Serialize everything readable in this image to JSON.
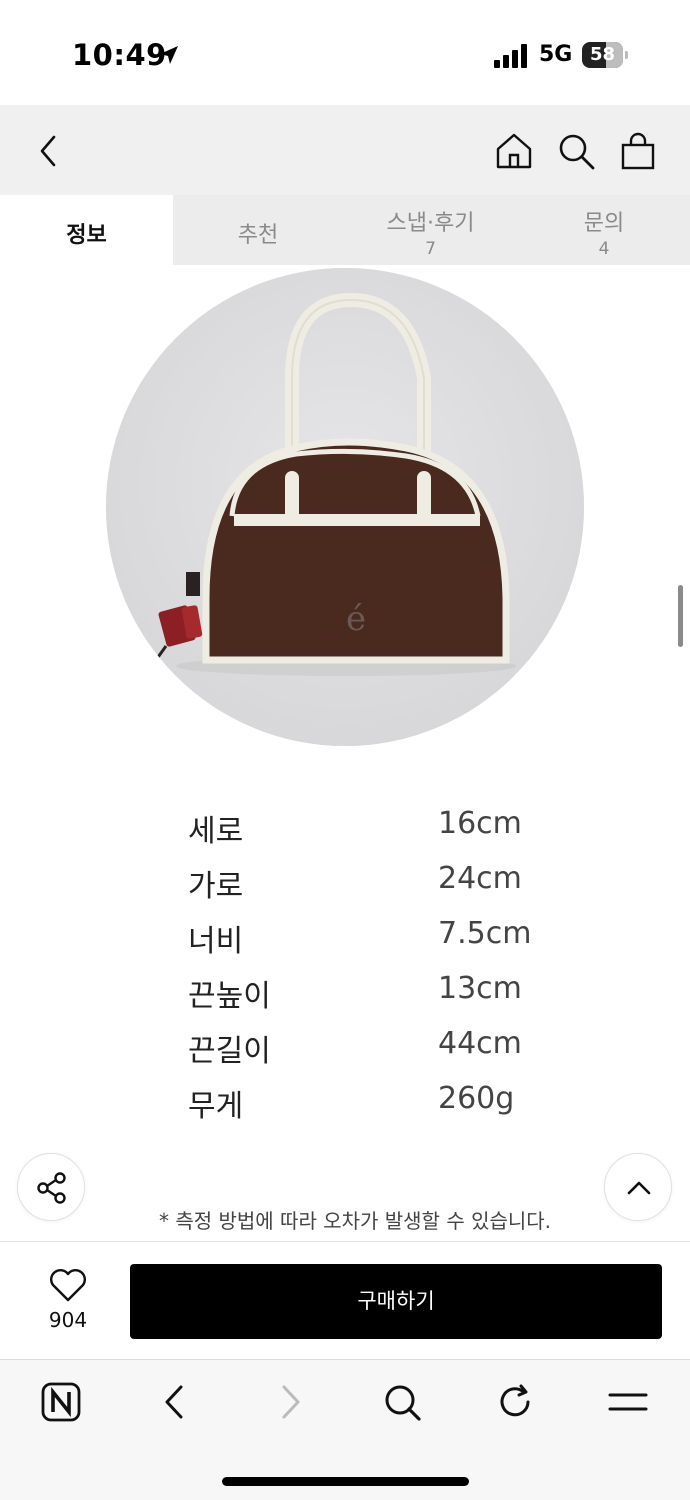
{
  "status_bar": {
    "time": "10:49",
    "network": "5G",
    "battery": "58"
  },
  "header": {
    "back_icon": "chevron-left-icon",
    "home_icon": "home-icon",
    "search_icon": "search-icon",
    "cart_icon": "shopping-bag-icon"
  },
  "tabs": [
    {
      "label": "정보",
      "count": "",
      "active": true
    },
    {
      "label": "추천",
      "count": "",
      "active": false
    },
    {
      "label": "스냅·후기",
      "count": "7",
      "active": false
    },
    {
      "label": "문의",
      "count": "4",
      "active": false
    }
  ],
  "product_image": {
    "logo_text": "é"
  },
  "specs": [
    {
      "label": "세로",
      "value": "16cm"
    },
    {
      "label": "가로",
      "value": "24cm"
    },
    {
      "label": "너비",
      "value": "7.5cm"
    },
    {
      "label": "끈높이",
      "value": "13cm"
    },
    {
      "label": "끈길이",
      "value": "44cm"
    },
    {
      "label": "무게",
      "value": "260g"
    }
  ],
  "notice": "* 측정 방법에 따라 오차가 발생할 수 있습니다.",
  "buy_bar": {
    "like_count": "904",
    "buy_label": "구매하기"
  },
  "colors": {
    "buy_button": "#000000",
    "header_bg": "#f0f0f0",
    "bag_body": "#4a2a1f",
    "bag_trim": "#efece4"
  }
}
